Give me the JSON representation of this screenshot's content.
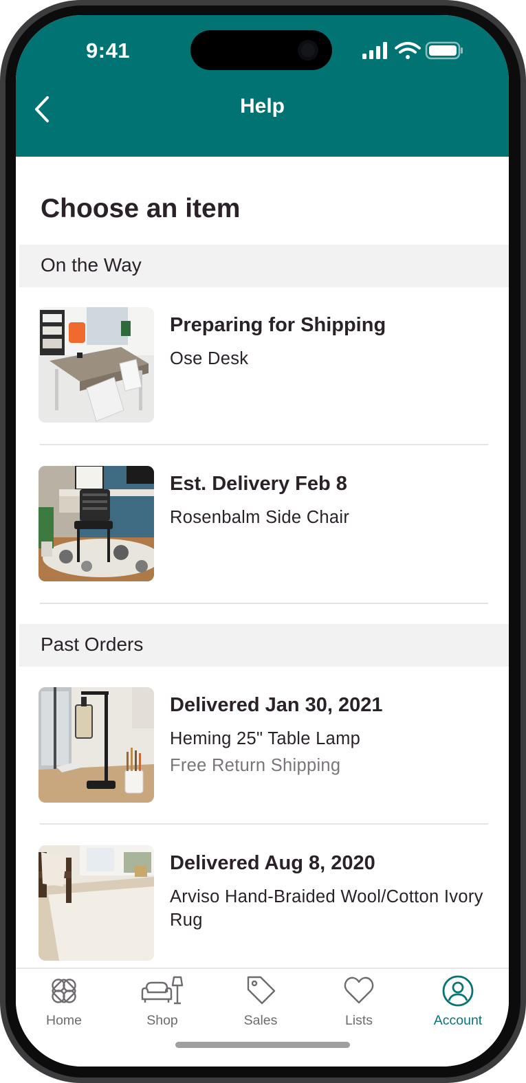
{
  "status_bar": {
    "time": "9:41"
  },
  "header": {
    "title": "Help"
  },
  "main": {
    "title": "Choose an item",
    "sections": [
      {
        "label": "On the Way",
        "items": [
          {
            "status": "Preparing for Shipping",
            "name": "Ose Desk",
            "note": ""
          },
          {
            "status": "Est. Delivery Feb 8",
            "name": "Rosenbalm Side Chair",
            "note": ""
          }
        ]
      },
      {
        "label": "Past Orders",
        "items": [
          {
            "status": "Delivered Jan 30, 2021",
            "name": "Heming 25\" Table Lamp",
            "note": "Free Return Shipping"
          },
          {
            "status": "Delivered Aug 8, 2020",
            "name": "Arviso Hand-Braided Wool/Cotton Ivory Rug",
            "note": ""
          }
        ]
      }
    ]
  },
  "tabbar": {
    "tabs": [
      {
        "label": "Home",
        "icon": "home-icon"
      },
      {
        "label": "Shop",
        "icon": "shop-icon"
      },
      {
        "label": "Sales",
        "icon": "sales-tag-icon"
      },
      {
        "label": "Lists",
        "icon": "heart-icon"
      },
      {
        "label": "Account",
        "icon": "account-icon",
        "active": true
      }
    ]
  },
  "colors": {
    "brand": "#027373",
    "accent": "#0a7373",
    "text": "#2a2129",
    "muted": "#7a757a",
    "section_bg": "#f2f2f2"
  }
}
